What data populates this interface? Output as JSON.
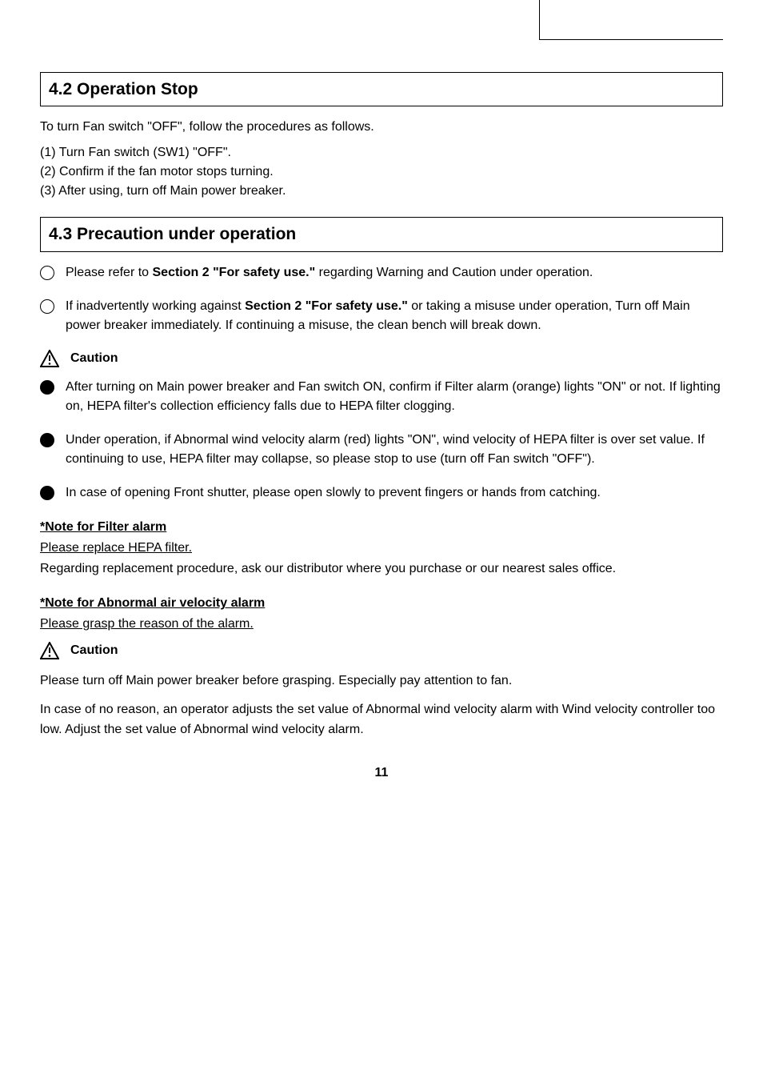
{
  "section1": {
    "title": "4.2 Operation Stop",
    "intro": "To turn Fan switch \"OFF\", follow the procedures as follows.",
    "steps": "(1) Turn Fan switch (SW1) \"OFF\".\n(2) Confirm if the fan motor stops turning.\n(3) After using, turn off Main power breaker."
  },
  "section2": {
    "title": "4.3 Precaution under operation",
    "bullets": [
      {
        "type": "circle",
        "textBefore": "Please refer to ",
        "bold": "Section 2 \"For safety use.\"",
        "textAfter": " regarding Warning and Caution under operation."
      },
      {
        "type": "circle",
        "textBefore": "If inadvertently working against ",
        "bold": "Section 2 \"For safety use.\"",
        "textAfter": " or taking a misuse under operation, Turn off Main power breaker immediately. If continuing a misuse, the clean bench will break down."
      }
    ],
    "cautionLabel": "Caution",
    "cautions": [
      "After turning on Main power breaker and Fan switch ON, confirm if Filter alarm (orange) lights \"ON\" or not. If lighting on, HEPA filter's collection efficiency falls due to HEPA filter clogging.",
      "Under operation, if Abnormal wind velocity alarm (red) lights \"ON\", wind velocity of HEPA filter is over set value. If continuing to use, HEPA filter may collapse, so please stop to use (turn off Fan switch \"OFF\").",
      "In case of opening Front shutter, please open slowly to prevent fingers or hands from catching."
    ],
    "note1": {
      "title": "*Note for Filter alarm",
      "body": "Please replace HEPA filter.",
      "text": "Regarding replacement procedure, ask our distributor where you purchase or our nearest sales office."
    },
    "note2": {
      "title": "*Note for Abnormal air velocity alarm",
      "body": "Please grasp the reason of the alarm.",
      "cautionLabel": "Caution",
      "cautionText": "Please turn off Main power breaker before grasping. Especially pay attention to fan.",
      "text": "In case of no reason, an operator adjusts the set value of Abnormal wind velocity alarm with Wind velocity controller too low. Adjust the set value of Abnormal wind velocity alarm."
    }
  },
  "pageNumber": "11"
}
